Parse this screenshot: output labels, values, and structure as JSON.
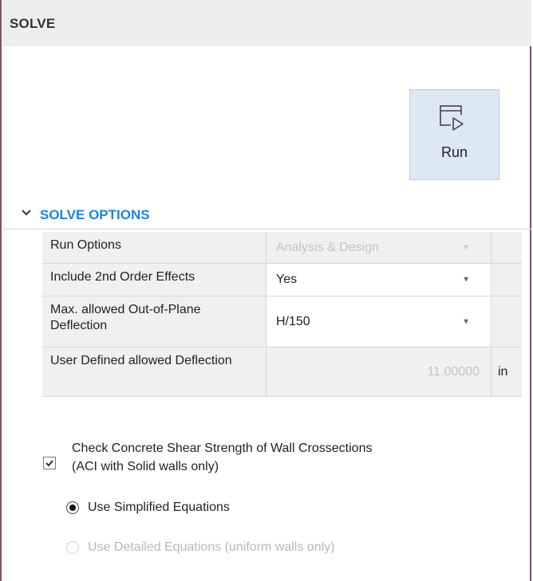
{
  "header": {
    "title": "SOLVE"
  },
  "run_button": {
    "label": "Run",
    "icon": "run-play-icon"
  },
  "section": {
    "title": "SOLVE OPTIONS",
    "expanded": true,
    "icon": "chevron-down-icon"
  },
  "options": [
    {
      "label": "Run Options",
      "value": "Analysis & Design",
      "type": "dropdown",
      "enabled": false
    },
    {
      "label": "Include 2nd Order Effects",
      "value": "Yes",
      "type": "dropdown",
      "enabled": true
    },
    {
      "label": "Max. allowed Out-of-Plane Deflection",
      "value": "H/150",
      "type": "dropdown",
      "enabled": true
    },
    {
      "label": "User Defined allowed Deflection",
      "value": "11.00000",
      "unit": "in",
      "type": "number",
      "enabled": false
    }
  ],
  "shear_check": {
    "label_line1": "Check Concrete Shear Strength of Wall Crossections",
    "label_line2": "(ACI with Solid walls only)",
    "checked": true
  },
  "radios": [
    {
      "label": "Use Simplified Equations",
      "selected": true,
      "enabled": true
    },
    {
      "label": "Use Detailed Equations (uniform walls only)",
      "selected": false,
      "enabled": false
    }
  ]
}
